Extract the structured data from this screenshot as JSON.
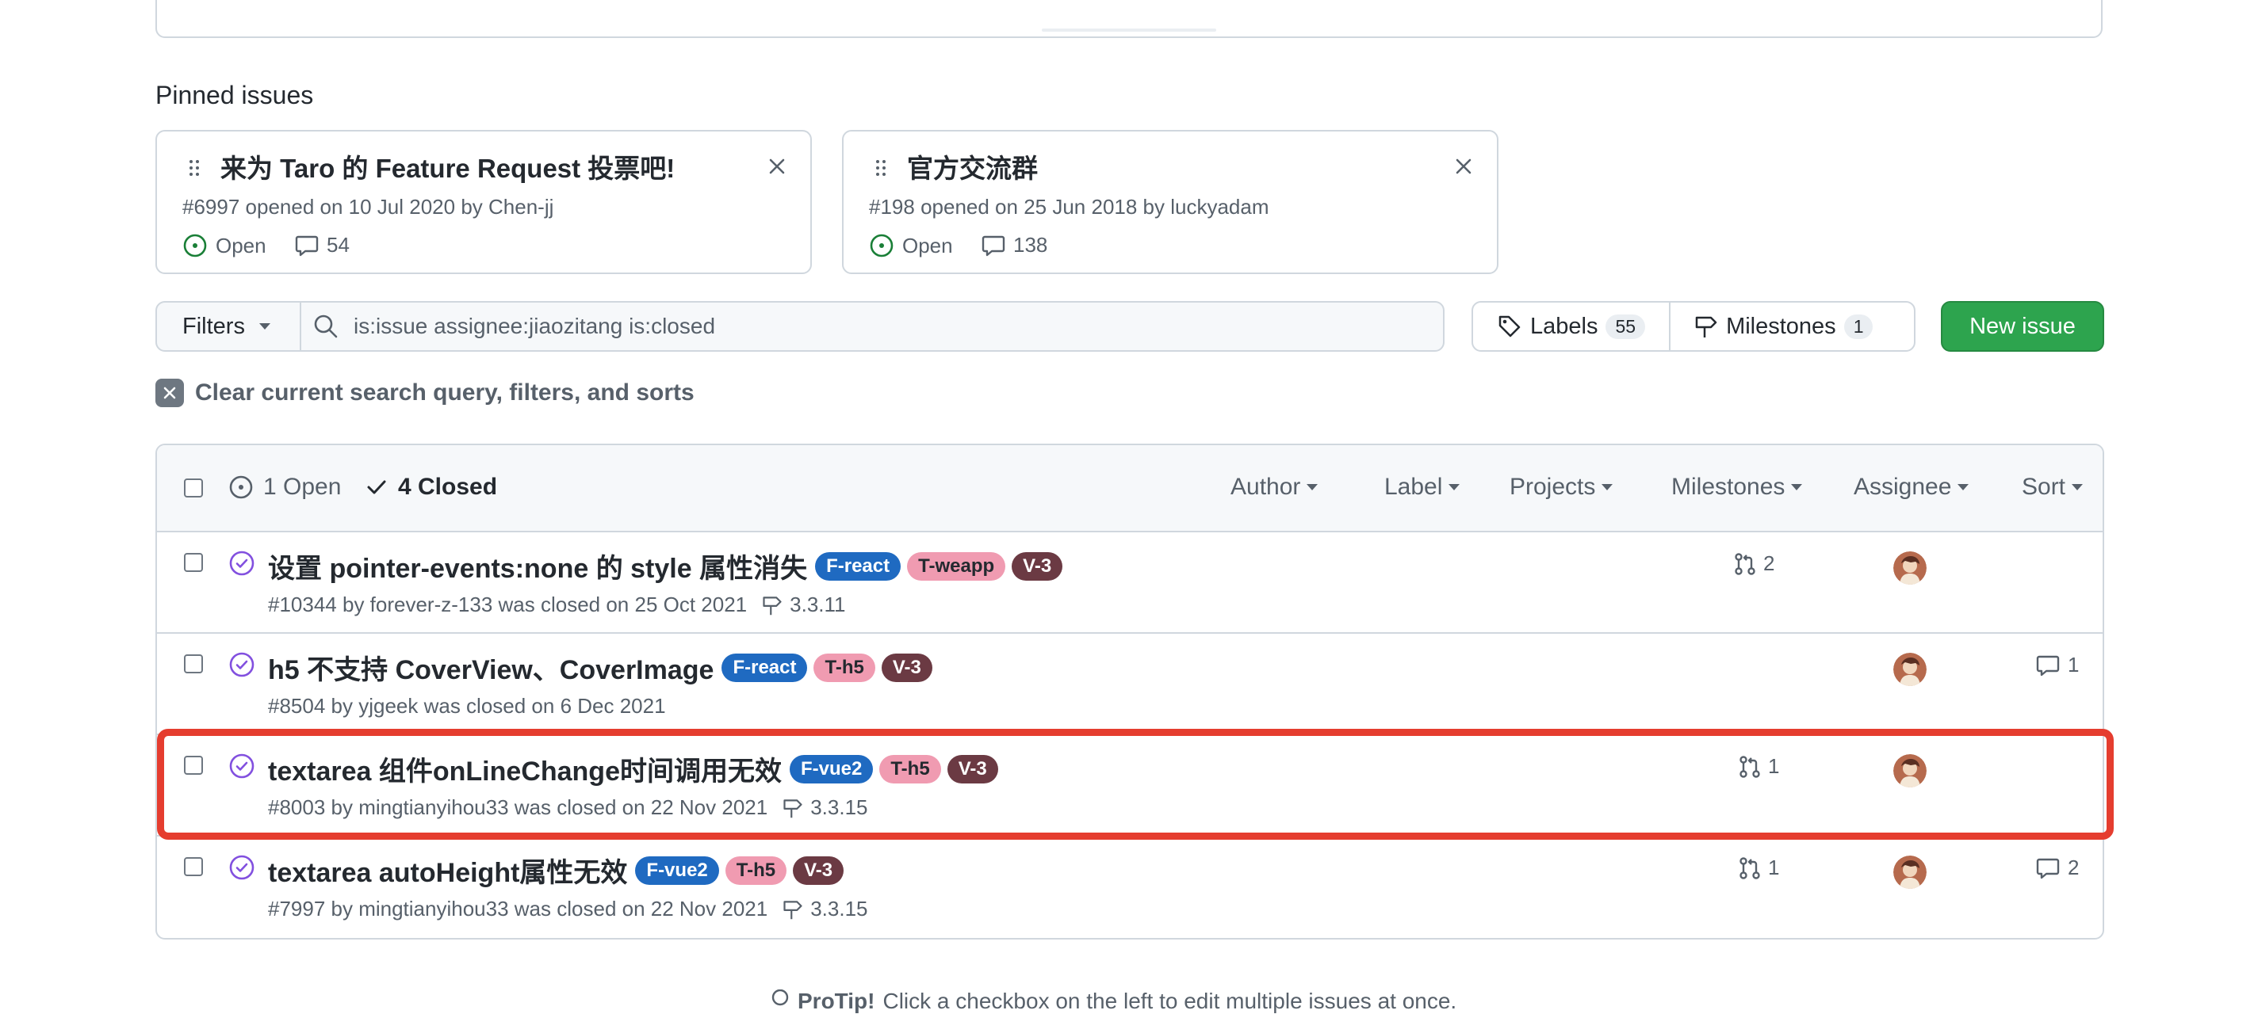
{
  "pinned": {
    "heading": "Pinned issues",
    "cards": [
      {
        "title": "来为 Taro 的 Feature Request 投票吧!",
        "meta": "#6997 opened on 10 Jul 2020 by Chen-jj",
        "state": "Open",
        "comments": "54"
      },
      {
        "title": "官方交流群",
        "meta": "#198 opened on 25 Jun 2018 by luckyadam",
        "state": "Open",
        "comments": "138"
      }
    ]
  },
  "toolbar": {
    "filters_label": "Filters",
    "search_value": "is:issue assignee:jiaozitang is:closed",
    "labels_label": "Labels",
    "labels_count": "55",
    "milestones_label": "Milestones",
    "milestones_count": "1",
    "new_issue_label": "New issue"
  },
  "clear_filters_label": "Clear current search query, filters, and sorts",
  "list_header": {
    "open_label": "1 Open",
    "closed_label": "4 Closed",
    "filters": [
      "Author",
      "Label",
      "Projects",
      "Milestones",
      "Assignee",
      "Sort"
    ]
  },
  "issues": [
    {
      "title": "设置 pointer-events:none 的 style 属性消失",
      "labels": [
        {
          "text": "F-react",
          "bg": "#1f6ac1",
          "fg": "#ffffff"
        },
        {
          "text": "T-weapp",
          "bg": "#f09bb1",
          "fg": "#24292f"
        },
        {
          "text": "V-3",
          "bg": "#6b3a43",
          "fg": "#ffffff"
        }
      ],
      "meta": "#10344 by forever-z-133 was closed on 25 Oct 2021",
      "milestone": "3.3.11",
      "linked_prs": "2",
      "comments": ""
    },
    {
      "title": "h5 不支持 CoverView、CoverImage",
      "labels": [
        {
          "text": "F-react",
          "bg": "#1f6ac1",
          "fg": "#ffffff"
        },
        {
          "text": "T-h5",
          "bg": "#f09bb1",
          "fg": "#24292f"
        },
        {
          "text": "V-3",
          "bg": "#6b3a43",
          "fg": "#ffffff"
        }
      ],
      "meta": "#8504 by yjgeek was closed on 6 Dec 2021",
      "milestone": "",
      "linked_prs": "",
      "comments": "1"
    },
    {
      "title": "textarea 组件onLineChange时间调用无效",
      "labels": [
        {
          "text": "F-vue2",
          "bg": "#1f6ac1",
          "fg": "#ffffff"
        },
        {
          "text": "T-h5",
          "bg": "#f09bb1",
          "fg": "#24292f"
        },
        {
          "text": "V-3",
          "bg": "#6b3a43",
          "fg": "#ffffff"
        }
      ],
      "meta": "#8003 by mingtianyihou33 was closed on 22 Nov 2021",
      "milestone": "3.3.15",
      "linked_prs": "1",
      "comments": ""
    },
    {
      "title": "textarea autoHeight属性无效",
      "labels": [
        {
          "text": "F-vue2",
          "bg": "#1f6ac1",
          "fg": "#ffffff"
        },
        {
          "text": "T-h5",
          "bg": "#f09bb1",
          "fg": "#24292f"
        },
        {
          "text": "V-3",
          "bg": "#6b3a43",
          "fg": "#ffffff"
        }
      ],
      "meta": "#7997 by mingtianyihou33 was closed on 22 Nov 2021",
      "milestone": "3.3.15",
      "linked_prs": "1",
      "comments": "2"
    }
  ],
  "protip": {
    "strong": "ProTip!",
    "text": "Click a checkbox on the left to edit multiple issues at once."
  },
  "colors": {
    "accent_green": "#2da44e",
    "closed_purple": "#8250df",
    "open_green": "#1a7f37",
    "highlight_red": "#e53d2f"
  }
}
